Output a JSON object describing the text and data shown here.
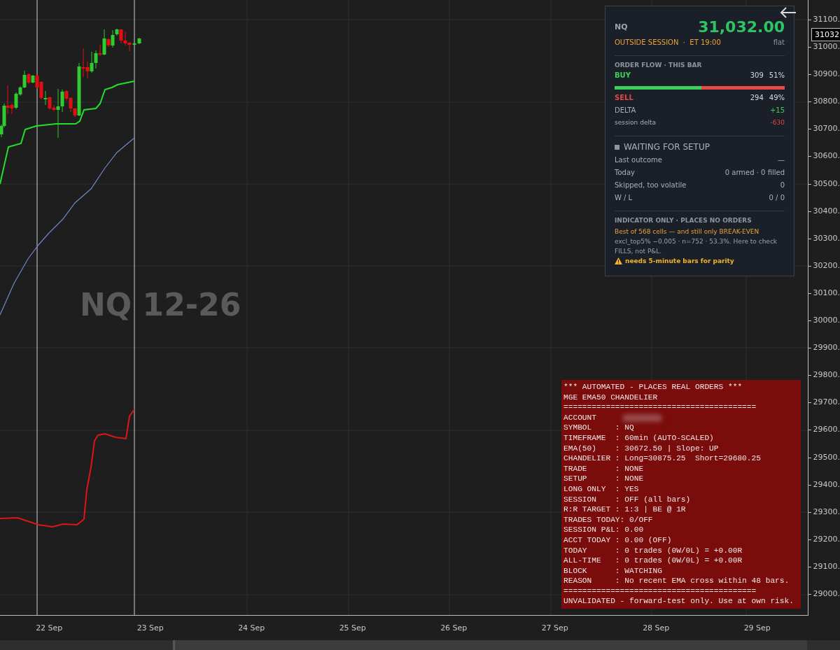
{
  "chart": {
    "watermark": "NQ 12-26"
  },
  "price_axis": {
    "labels": [
      "31100.",
      "31000.",
      "30900.",
      "30800.",
      "30700.",
      "30600.",
      "30500.",
      "30400.",
      "30300.",
      "30200.",
      "30100.",
      "30000.",
      "29900.",
      "29800.",
      "29700.",
      "29600.",
      "29500.",
      "29400.",
      "29300.",
      "29200.",
      "29100.",
      "29000."
    ],
    "current_price": "31032."
  },
  "time_axis": {
    "labels": [
      "22 Sep",
      "23 Sep",
      "24 Sep",
      "25 Sep",
      "26 Sep",
      "27 Sep",
      "28 Sep",
      "29 Sep"
    ]
  },
  "panel": {
    "symbol": "NQ",
    "price": "31,032.00",
    "session": "OUTSIDE SESSION  ·  ET 19:00",
    "position": "flat",
    "order_flow": {
      "title": "ORDER FLOW · THIS BAR",
      "buy": {
        "label": "BUY",
        "count": "309",
        "percent": "51%"
      },
      "level": 0.51,
      "sell": {
        "label": "SELL",
        "count": "294",
        "percent": "49%"
      },
      "rows": [
        {
          "kind": "delta",
          "label": "DELTA",
          "value": "+15"
        },
        {
          "kind": "session",
          "label": "session delta",
          "value": "-630"
        }
      ]
    },
    "status": {
      "title": "WAITING FOR SETUP",
      "rows": [
        {
          "label": "Last outcome",
          "value": "—"
        },
        {
          "label": "Today",
          "value": "0 armed · 0 filled"
        },
        {
          "label": "Skipped, too volatile",
          "value": "0"
        },
        {
          "label": "W / L",
          "value": "0 / 0"
        }
      ]
    },
    "note": {
      "title": "INDICATOR ONLY · PLACES NO ORDERS",
      "highlight": "Best of 568 cells — and still only BREAK-EVEN",
      "text": "excl_top5% −0.005 · n=752 · 53.3%. Here to check FILLS, not P&L.",
      "warning": "needs 5-minute bars for parity"
    }
  },
  "strategy_box": {
    "lines": [
      {
        "kind": "text",
        "text": "*** AUTOMATED - PLACES REAL ORDERS ***"
      },
      {
        "kind": "text",
        "text": "MGE EMA50 CHANDELIER"
      },
      {
        "kind": "rule",
        "text": "========================================="
      },
      {
        "kind": "redacted",
        "text": "ACCOUNT"
      },
      {
        "kind": "text",
        "text": "SYMBOL     : NQ"
      },
      {
        "kind": "text",
        "text": "TIMEFRAME  : 60min (AUTO-SCALED)"
      },
      {
        "kind": "text",
        "text": "EMA(50)    : 30672.50 | Slope: UP"
      },
      {
        "kind": "text",
        "text": "CHANDELIER : Long=30875.25  Short=29680.25"
      },
      {
        "kind": "text",
        "text": "TRADE      : NONE"
      },
      {
        "kind": "text",
        "text": "SETUP      : NONE"
      },
      {
        "kind": "text",
        "text": "LONG ONLY  : YES"
      },
      {
        "kind": "text",
        "text": "SESSION    : OFF (all bars)"
      },
      {
        "kind": "text",
        "text": "R:R TARGET : 1:3 | BE @ 1R"
      },
      {
        "kind": "text",
        "text": "TRADES TODAY: 0/OFF"
      },
      {
        "kind": "text",
        "text": "SESSION P&L: 0.00"
      },
      {
        "kind": "text",
        "text": "ACCT TODAY : 0.00 (OFF)"
      },
      {
        "kind": "text",
        "text": "TODAY      : 0 trades (0W/0L) = +0.00R"
      },
      {
        "kind": "text",
        "text": "ALL-TIME   : 0 trades (0W/0L) = +0.00R"
      },
      {
        "kind": "text",
        "text": "BLOCK      : WATCHING"
      },
      {
        "kind": "text",
        "text": "REASON     : No recent EMA cross within 48 bars."
      },
      {
        "kind": "rule",
        "text": "========================================="
      },
      {
        "kind": "text",
        "text": "UNVALIDATED - forward-test only. Use at own risk."
      }
    ]
  }
}
